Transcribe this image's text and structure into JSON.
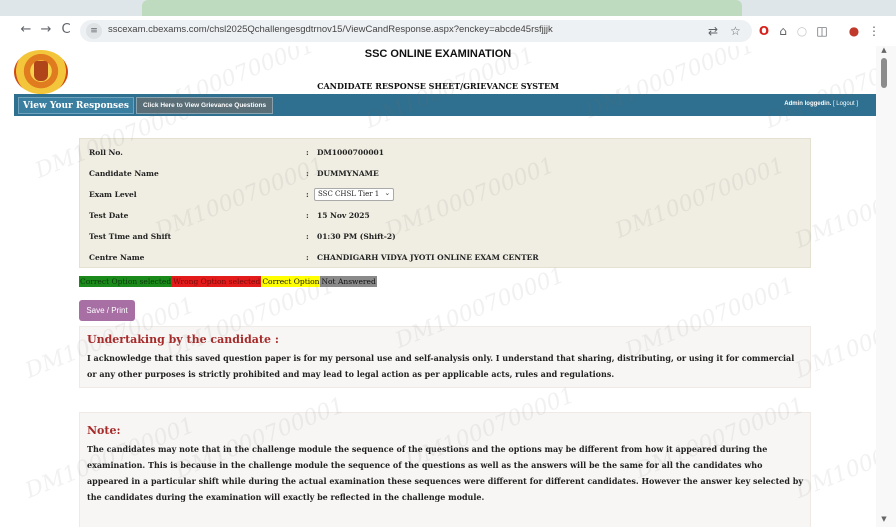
{
  "browser": {
    "url": "sscexam.cbexams.com/chsl2025Qchallengesgdtrnov15/ViewCandResponse.aspx?enckey=abcde45rsfjjjk",
    "site_icon": "site-info-icon"
  },
  "header": {
    "title": "SSC ONLINE EXAMINATION",
    "subtitle": "CANDIDATE RESPONSE SHEET/GRIEVANCE SYSTEM"
  },
  "navbar": {
    "view_responses": "View Your Responses",
    "grievance": "Click Here to View Grievance Questions",
    "admin_status": "Admin loggedin.",
    "logout": "[ Logout ]"
  },
  "watermark": "DM1000700001",
  "candidate": {
    "rows": [
      {
        "label": "Roll No.",
        "value": "DM1000700001"
      },
      {
        "label": "Candidate Name",
        "value": "DUMMYNAME"
      },
      {
        "label": "Exam Level",
        "value": "SSC CHSL Tier 1"
      },
      {
        "label": "Test Date",
        "value": "15 Nov 2025"
      },
      {
        "label": "Test Time and Shift",
        "value": "01:30 PM (Shift-2)"
      },
      {
        "label": "Centre Name",
        "value": "CHANDIGARH VIDYA JYOTI ONLINE EXAM CENTER"
      }
    ],
    "colon": ":"
  },
  "legend": {
    "correct_selected": "Correct Option selected",
    "wrong_selected": "Wrong Option selected",
    "correct": "Correct Option",
    "not_answered": "Not Answered"
  },
  "save_print": "Save / Print",
  "undertaking": {
    "heading": "Undertaking by the candidate :",
    "text": "I acknowledge that this saved question paper is for my personal use and self-analysis only. I understand that sharing, distributing, or using it for commercial or any other purposes is strictly prohibited and may lead to legal action as per applicable acts, rules and regulations."
  },
  "note": {
    "heading": "Note:",
    "text": "The candidates may note that in the challenge module the sequence of the questions and the options may be different from how it appeared during the examination. This is because in the challenge module the sequence of the questions as well as the answers will be the same for all the candidates who appeared in a particular shift while during the actual examination these sequences were different for different candidates. However the answer key selected by the candidates during the examination will exactly be reflected in the challenge module."
  },
  "colors": {
    "navbar": "#2f6f8f",
    "info_bg": "#f0eee2",
    "save_btn": "#a86fa5",
    "heading": "#a52a2a"
  }
}
